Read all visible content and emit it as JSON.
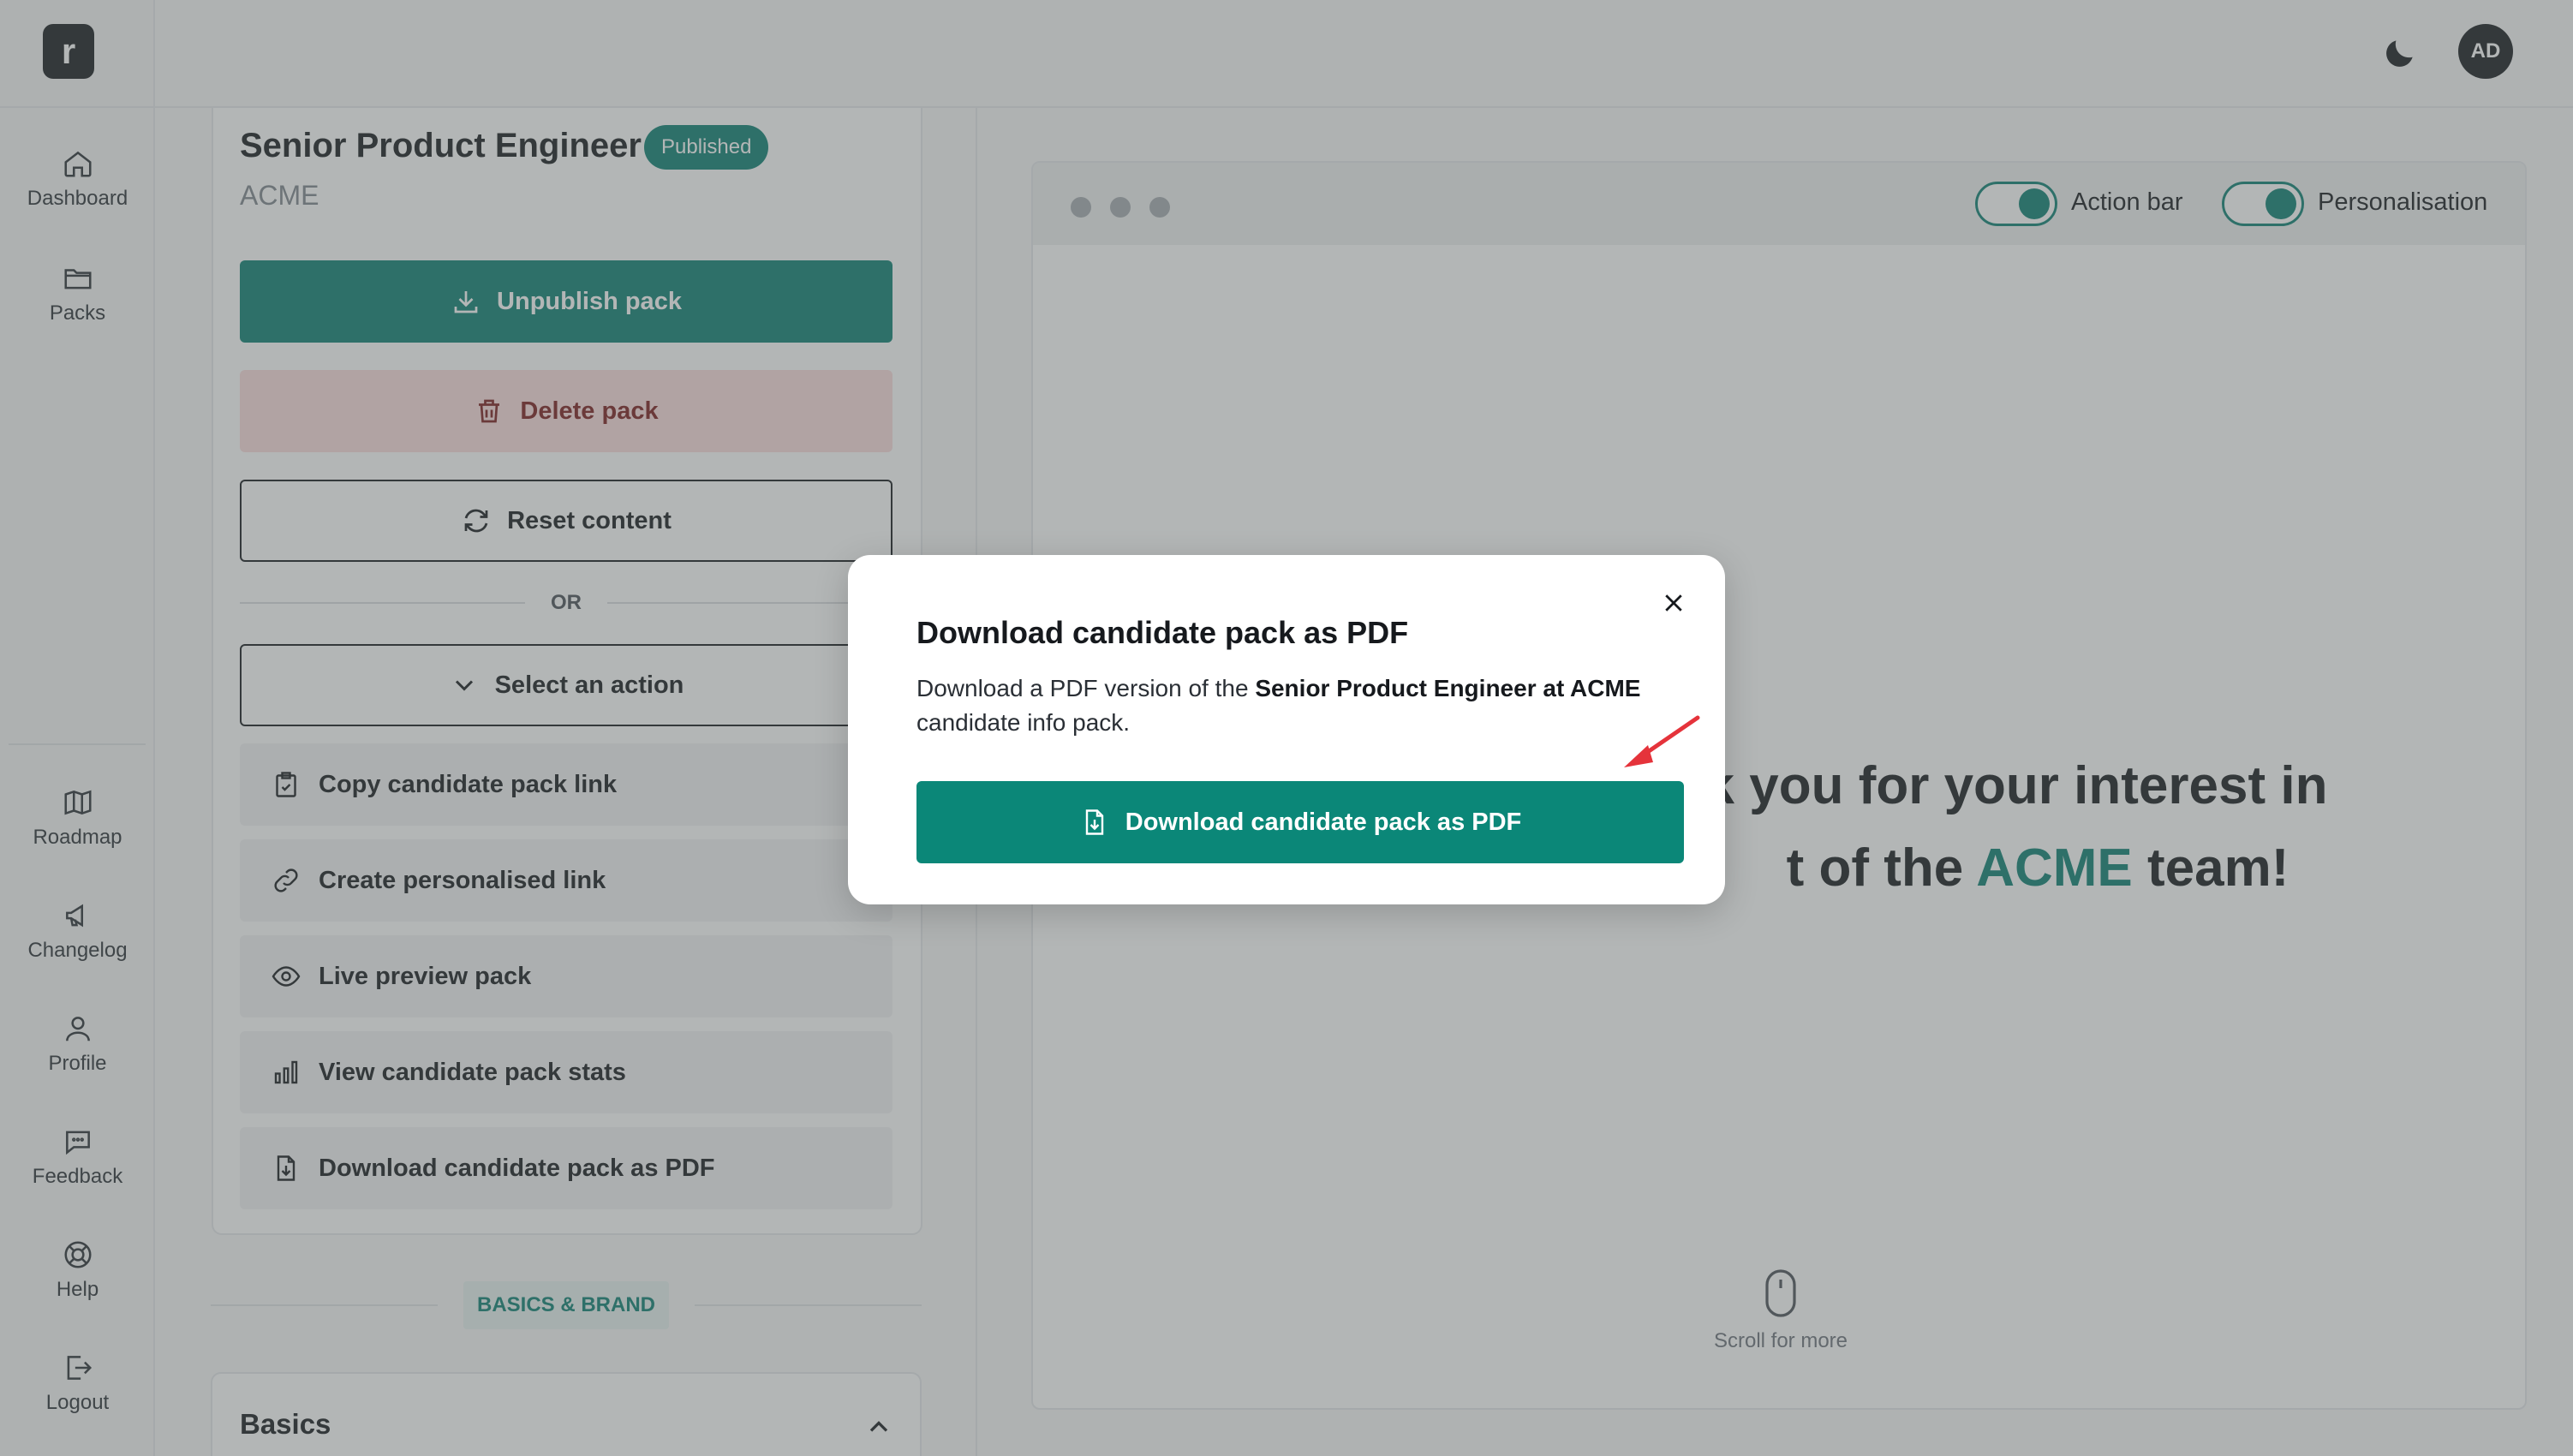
{
  "sidebar": {
    "logo": "r",
    "top_items": [
      {
        "label": "Dashboard",
        "icon": "home-icon"
      },
      {
        "label": "Packs",
        "icon": "folder-icon"
      }
    ],
    "bottom_items": [
      {
        "label": "Roadmap",
        "icon": "map-icon"
      },
      {
        "label": "Changelog",
        "icon": "megaphone-icon"
      },
      {
        "label": "Profile",
        "icon": "user-icon"
      },
      {
        "label": "Feedback",
        "icon": "chat-icon"
      },
      {
        "label": "Help",
        "icon": "lifebuoy-icon"
      },
      {
        "label": "Logout",
        "icon": "logout-icon"
      }
    ]
  },
  "topbar": {
    "avatar_initials": "AD",
    "theme_icon": "moon-icon"
  },
  "pack": {
    "title": "Senior Product Engineer",
    "status": "Published",
    "company": "ACME",
    "unpublish_label": "Unpublish pack",
    "delete_label": "Delete pack",
    "reset_label": "Reset content",
    "or_label": "OR",
    "select_action_label": "Select an action",
    "actions": [
      {
        "label": "Copy candidate pack link",
        "icon": "clipboard-check-icon"
      },
      {
        "label": "Create personalised link",
        "icon": "link-icon"
      },
      {
        "label": "Live preview pack",
        "icon": "eye-icon"
      },
      {
        "label": "View candidate pack stats",
        "icon": "bar-chart-icon"
      },
      {
        "label": "Download candidate pack as PDF",
        "icon": "file-download-icon"
      }
    ],
    "section_label": "BASICS & BRAND",
    "basics_label": "Basics"
  },
  "preview": {
    "toggles": [
      {
        "label": "Action bar",
        "on": true
      },
      {
        "label": "Personalisation",
        "on": true
      }
    ],
    "hero_line1": "k you for your interest in",
    "hero_line2_pre": "t of the ",
    "hero_brand": "ACME",
    "hero_line2_post": " team!",
    "scroll_label": "Scroll for more"
  },
  "modal": {
    "title": "Download candidate pack as PDF",
    "text_pre": "Download a PDF version of the ",
    "text_bold": "Senior Product Engineer at ACME",
    "text_post": " candidate info pack.",
    "button_label": "Download candidate pack as PDF"
  },
  "colors": {
    "accent": "#0b7f71",
    "danger_bg": "#fbdcdc",
    "danger_text": "#7a1b1b",
    "annotation_arrow": "#e5333b"
  }
}
